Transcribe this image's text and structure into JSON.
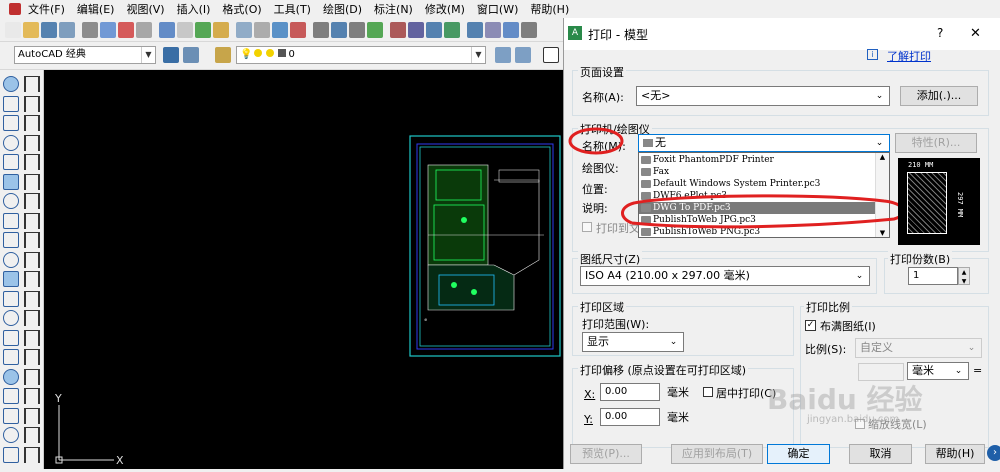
{
  "menu": [
    "文件(F)",
    "编辑(E)",
    "视图(V)",
    "插入(I)",
    "格式(O)",
    "工具(T)",
    "绘图(D)",
    "标注(N)",
    "修改(M)",
    "窗口(W)",
    "帮助(H)"
  ],
  "toolbar2": {
    "workspace": "AutoCAD 经典",
    "layer": "0"
  },
  "canvas": {
    "axis_y": "Y",
    "axis_x": "X"
  },
  "dialog": {
    "title": "打印 - 模型",
    "help_q": "?",
    "close": "✕",
    "learn_link": "了解打印",
    "page_setup": {
      "group": "页面设置",
      "name_label": "名称(A):",
      "name_value": "<无>",
      "add_button": "添加(.)..."
    },
    "printer": {
      "group": "打印机/绘图仪",
      "name_label": "名称(M):",
      "name_value": "无",
      "properties_button": "特性(R)...",
      "plotter_label": "绘图仪:",
      "location_label": "位置:",
      "desc_label": "说明:",
      "print_to_file": "打印到文",
      "options": [
        "Foxit PhantomPDF Printer",
        "Fax",
        "Default Windows System Printer.pc3",
        "DWF6 ePlot.pc3",
        "DWG To PDF.pc3",
        "PublishToWeb JPG.pc3",
        "PublishToWeb PNG.pc3"
      ],
      "selected_index": 4
    },
    "preview_paper": {
      "width": "210 MM",
      "height": "297 MM"
    },
    "paper_size": {
      "group": "图纸尺寸(Z)",
      "value": "ISO A4 (210.00 x 297.00 毫米)"
    },
    "copies": {
      "group": "打印份数(B)",
      "value": "1"
    },
    "plot_area": {
      "group": "打印区域",
      "range_label": "打印范围(W):",
      "range_value": "显示"
    },
    "plot_scale": {
      "group": "打印比例",
      "fit_label": "布满图纸(I)",
      "fit_checked": true,
      "scale_label": "比例(S):",
      "scale_value": "自定义",
      "unit": "毫米",
      "eq": "=",
      "lineweight": "缩放线宽(L)"
    },
    "offset": {
      "group": "打印偏移 (原点设置在可打印区域)",
      "x_label": "X:",
      "x_value": "0.00",
      "y_label": "Y:",
      "y_value": "0.00",
      "unit": "毫米",
      "center_label": "居中打印(C)"
    },
    "buttons": {
      "preview": "预览(P)...",
      "apply": "应用到布局(T)",
      "ok": "确定",
      "cancel": "取消",
      "help": "帮助(H)"
    },
    "watermark": {
      "main": "Baidu 经验",
      "sub": "jingyan.baidu.com"
    }
  }
}
